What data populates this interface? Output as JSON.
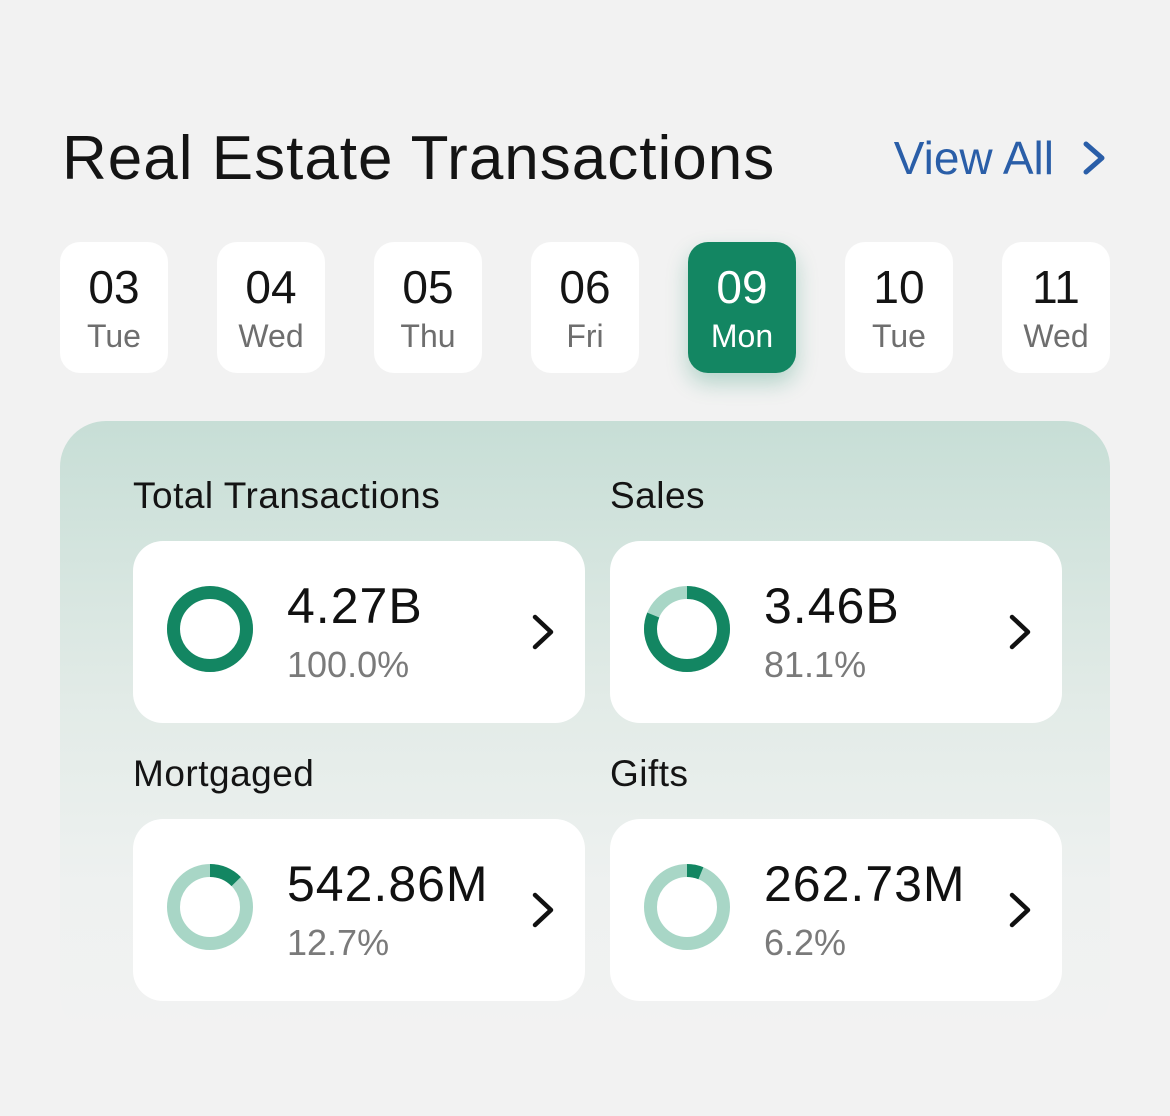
{
  "header": {
    "title": "Real Estate Transactions",
    "view_all_label": "View All",
    "view_all_color": "#2a5ea8"
  },
  "dates": [
    {
      "num": "03",
      "dow": "Tue",
      "selected": false
    },
    {
      "num": "04",
      "dow": "Wed",
      "selected": false
    },
    {
      "num": "05",
      "dow": "Thu",
      "selected": false
    },
    {
      "num": "06",
      "dow": "Fri",
      "selected": false
    },
    {
      "num": "09",
      "dow": "Mon",
      "selected": true
    },
    {
      "num": "10",
      "dow": "Tue",
      "selected": false
    },
    {
      "num": "11",
      "dow": "Wed",
      "selected": false
    }
  ],
  "colors": {
    "accent": "#138662",
    "ring_track_light": "#a8d6c6"
  },
  "stats": [
    {
      "label": "Total Transactions",
      "value": "4.27B",
      "percent": "100.0%",
      "fraction": 1.0
    },
    {
      "label": "Sales",
      "value": "3.46B",
      "percent": "81.1%",
      "fraction": 0.811
    },
    {
      "label": "Mortgaged",
      "value": "542.86M",
      "percent": "12.7%",
      "fraction": 0.127
    },
    {
      "label": "Gifts",
      "value": "262.73M",
      "percent": "6.2%",
      "fraction": 0.062
    }
  ]
}
